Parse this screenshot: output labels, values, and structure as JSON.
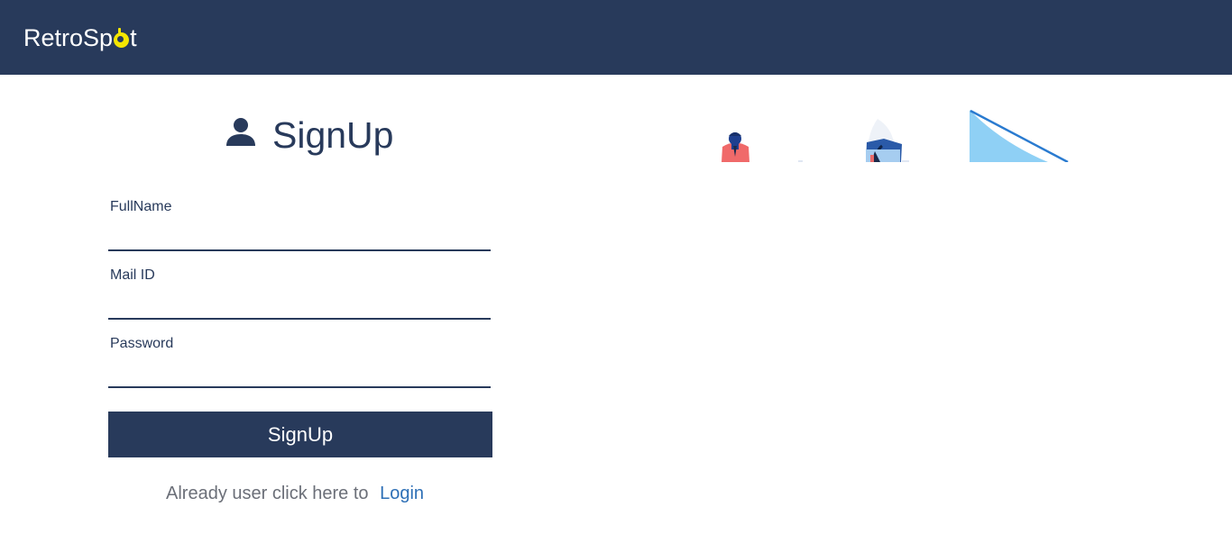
{
  "navbar": {
    "brand_prefix": "RetroSp",
    "brand_suffix": "t"
  },
  "form": {
    "title": "SignUp",
    "fields": [
      {
        "label": "FullName",
        "value": ""
      },
      {
        "label": "Mail ID",
        "value": ""
      },
      {
        "label": "Password",
        "value": ""
      }
    ],
    "submit_label": "SignUp",
    "login_prompt": "Already user click here to",
    "login_link": "Login"
  },
  "colors": {
    "primary": "#283a5b",
    "link": "#2d6fb6",
    "logo_accent": "#f5e600"
  }
}
